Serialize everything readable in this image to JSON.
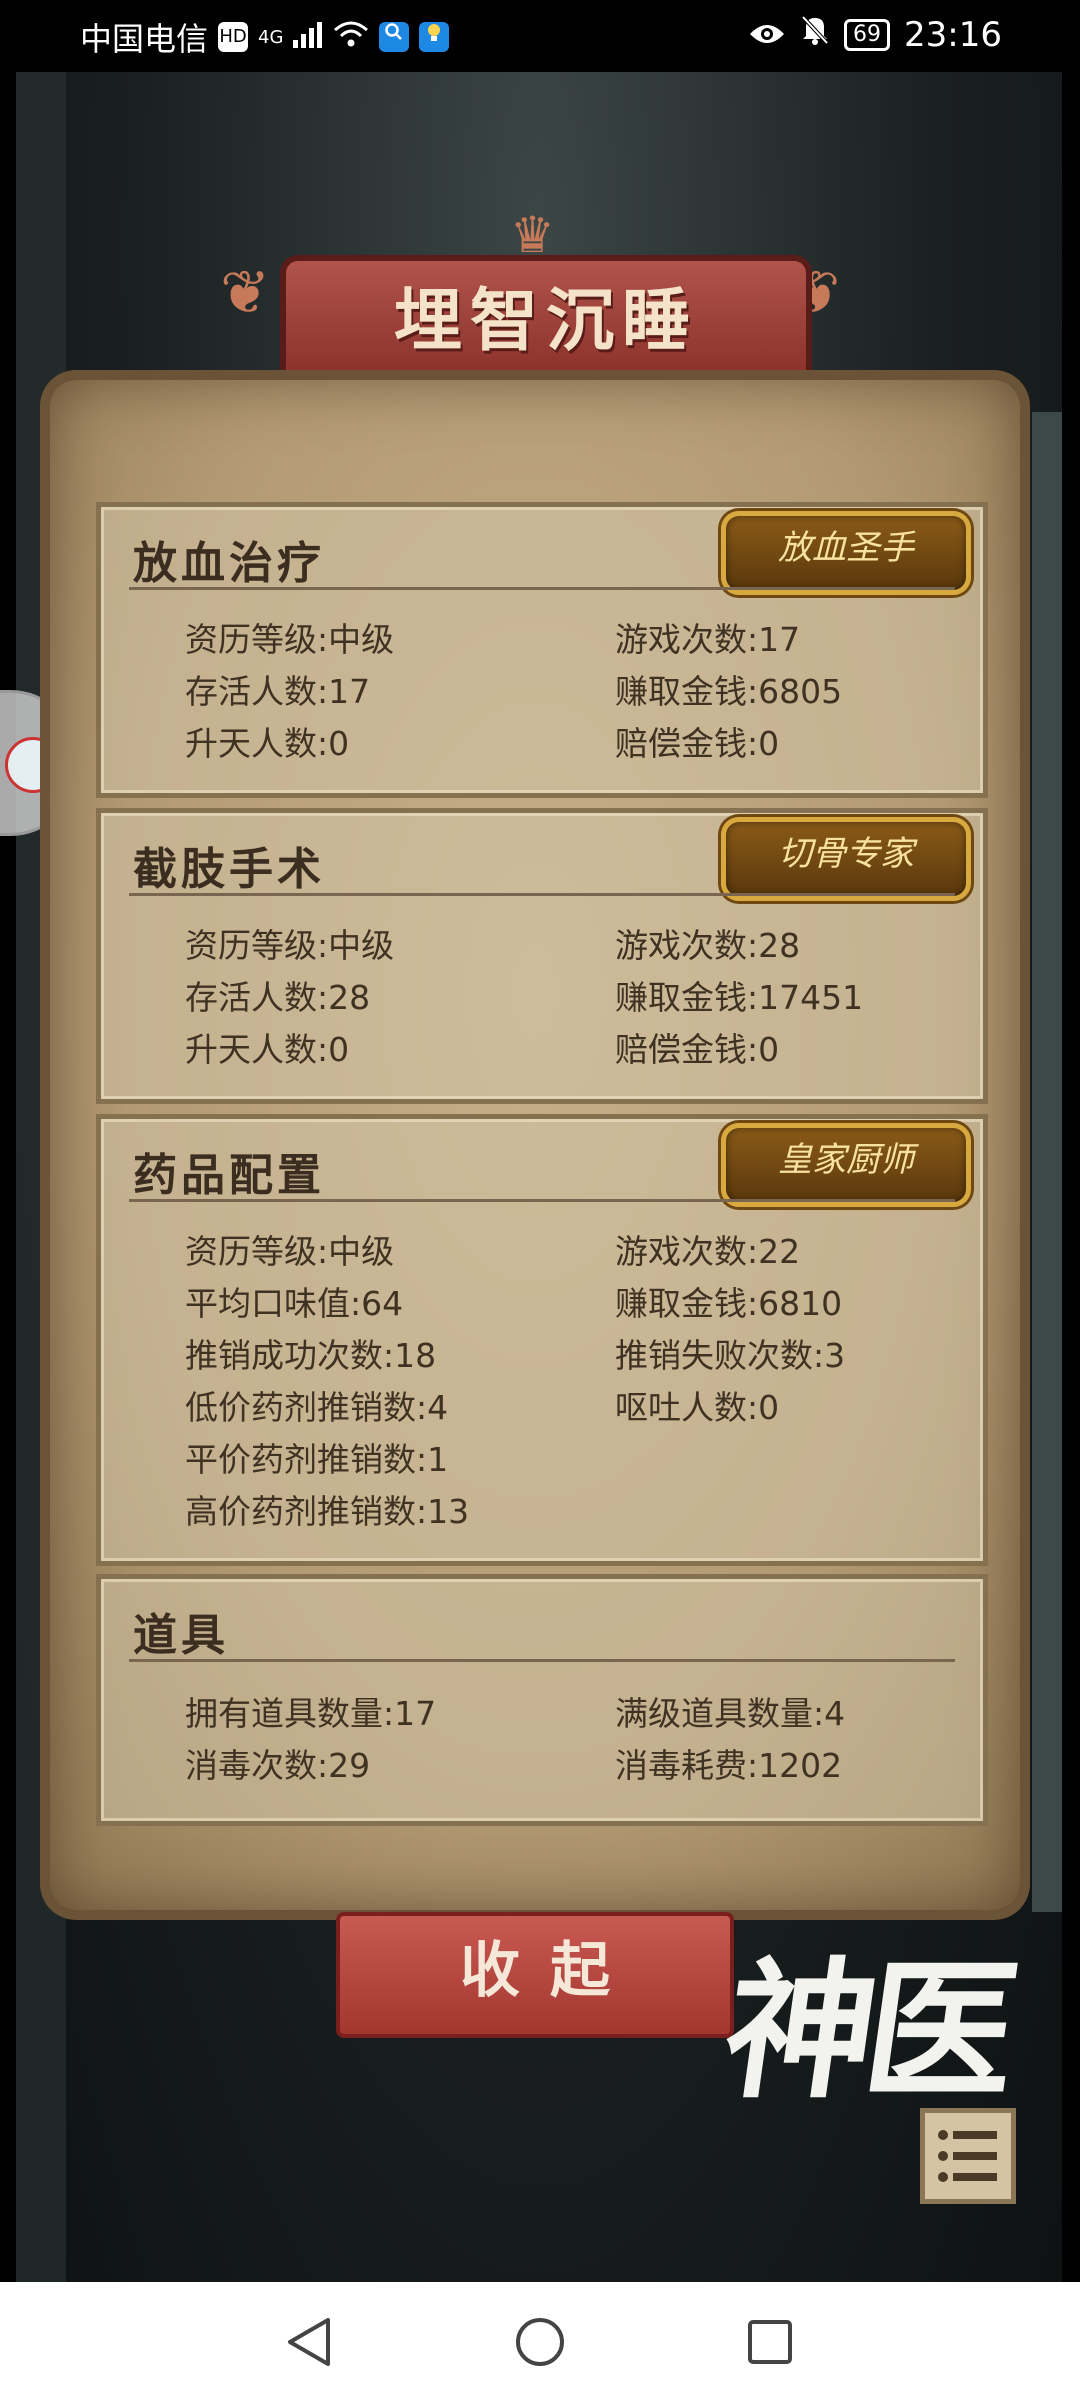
{
  "status_bar": {
    "carrier": "中国电信",
    "hd": "HD",
    "network": "4G",
    "battery": "69",
    "time": "23:16"
  },
  "banner": {
    "title": "埋智沉睡"
  },
  "sections": [
    {
      "title": "放血治疗",
      "badge": "放血圣手",
      "stats": [
        [
          "资历等级:中级",
          "游戏次数:17"
        ],
        [
          "存活人数:17",
          "赚取金钱:6805"
        ],
        [
          "升天人数:0",
          "赔偿金钱:0"
        ]
      ]
    },
    {
      "title": "截肢手术",
      "badge": "切骨专家",
      "stats": [
        [
          "资历等级:中级",
          "游戏次数:28"
        ],
        [
          "存活人数:28",
          "赚取金钱:17451"
        ],
        [
          "升天人数:0",
          "赔偿金钱:0"
        ]
      ]
    },
    {
      "title": "药品配置",
      "badge": "皇家厨师",
      "stats": [
        [
          "资历等级:中级",
          "游戏次数:22"
        ],
        [
          "平均口味值:64",
          "赚取金钱:6810"
        ],
        [
          "推销成功次数:18",
          "推销失败次数:3"
        ],
        [
          "低价药剂推销数:4",
          "呕吐人数:0"
        ],
        [
          "平价药剂推销数:1",
          ""
        ],
        [
          "高价药剂推销数:13",
          ""
        ]
      ]
    },
    {
      "title": "道具",
      "badge": "",
      "stats": [
        [
          "拥有道具数量:17",
          "满级道具数量:4"
        ],
        [
          "消毒次数:29",
          "消毒耗费:1202"
        ]
      ]
    }
  ],
  "collapse_button": {
    "label": "收起"
  },
  "logo": {
    "text": "神医"
  },
  "icons": {
    "eye": "eye-icon",
    "mute": "bell-off-icon",
    "wifi": "wifi-icon",
    "menu": "list-menu-icon",
    "back": "triangle-back-icon",
    "home": "circle-home-icon",
    "recent": "square-recent-icon"
  },
  "colors": {
    "parchment": "#b39a74",
    "banner": "#a3443b",
    "badge_gold": "#d8a93e",
    "button_red": "#b8463f"
  }
}
